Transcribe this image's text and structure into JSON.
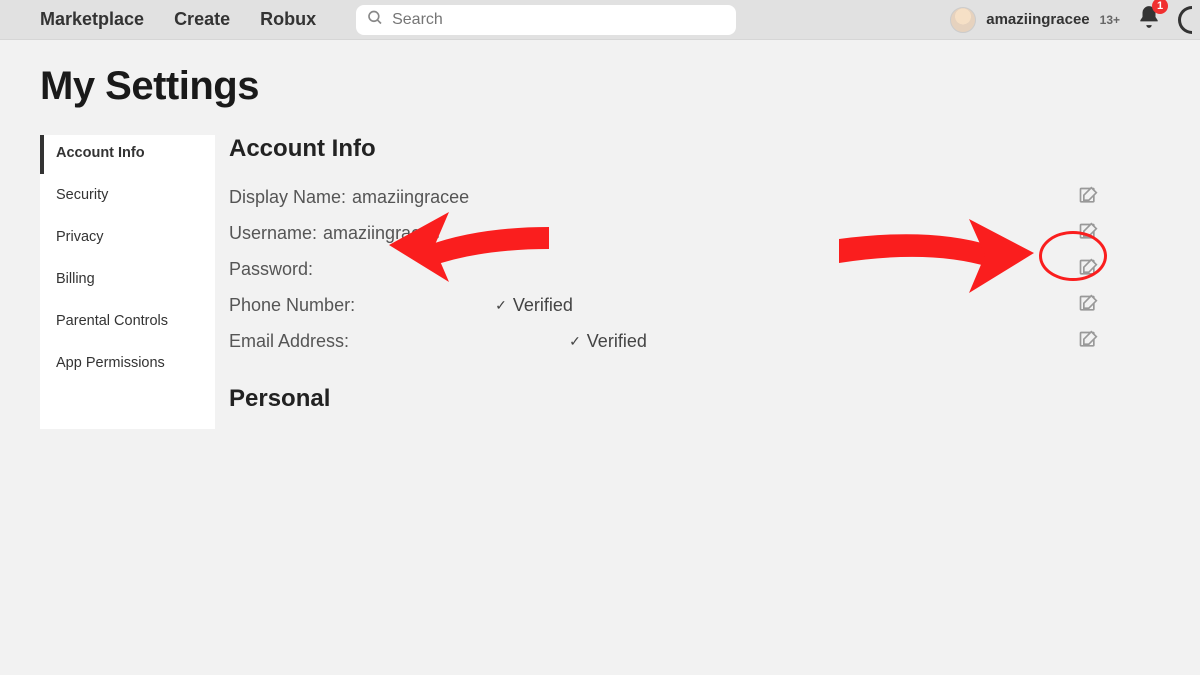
{
  "nav": {
    "marketplace": "Marketplace",
    "create": "Create",
    "robux": "Robux"
  },
  "search": {
    "placeholder": "Search"
  },
  "user": {
    "name": "amaziingracee",
    "age_label": "13+",
    "notif_count": "1"
  },
  "page": {
    "title": "My Settings"
  },
  "sidebar": {
    "items": [
      "Account Info",
      "Security",
      "Privacy",
      "Billing",
      "Parental Controls",
      "App Permissions"
    ]
  },
  "account_info": {
    "heading": "Account Info",
    "display_name_label": "Display Name:",
    "display_name_value": "amaziingracee",
    "username_label": "Username:",
    "username_value": "amaziingracee",
    "password_label": "Password:",
    "phone_label": "Phone Number:",
    "phone_verified": "Verified",
    "email_label": "Email Address:",
    "email_verified": "Verified"
  },
  "personal": {
    "heading": "Personal"
  }
}
